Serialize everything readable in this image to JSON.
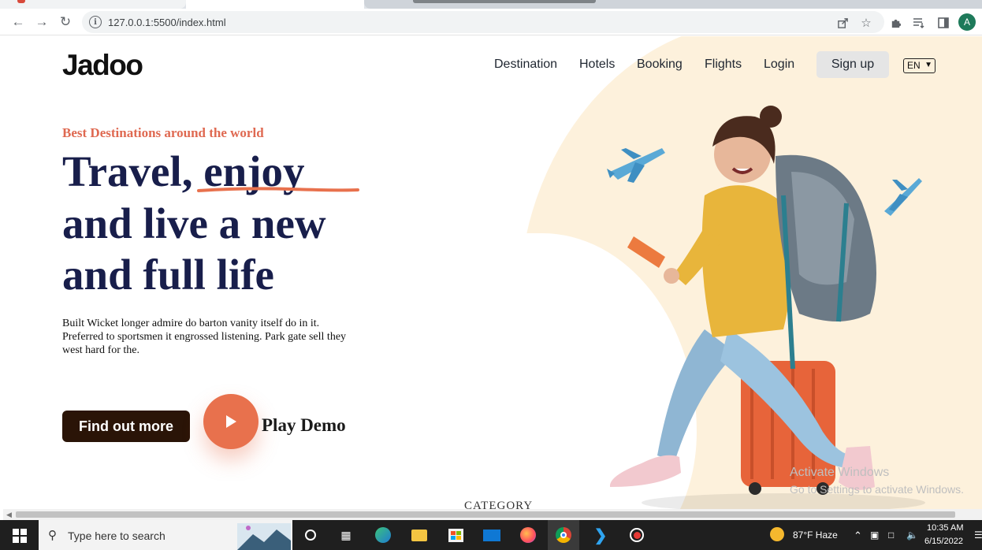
{
  "browser": {
    "url": "127.0.0.1:5500/index.html",
    "profile_initial": "A"
  },
  "page": {
    "logo": "Jadoo",
    "nav": {
      "destination": "Destination",
      "hotels": "Hotels",
      "booking": "Booking",
      "flights": "Flights",
      "login": "Login",
      "signup": "Sign up",
      "language": "EN"
    },
    "hero": {
      "eyebrow": "Best Destinations around the world",
      "line1a": "Travel,",
      "line1b": "enjoy",
      "line2": "and live a new",
      "line3": "and full life",
      "body": "Built Wicket longer admire do barton vanity itself do in it. Preferred to sportsmen it engrossed listening. Park gate sell they west hard for the.",
      "cta": "Find out more",
      "play_label": "Play Demo"
    },
    "category_label": "CATEGORY",
    "accent": "#df6951",
    "heading_color": "#181e4b"
  },
  "os": {
    "watermark_title": "Activate Windows",
    "watermark_sub": "Go to Settings to activate Windows.",
    "search_placeholder": "Type here to search",
    "weather": "87°F  Haze",
    "time": "10:35 AM",
    "date": "6/15/2022"
  }
}
